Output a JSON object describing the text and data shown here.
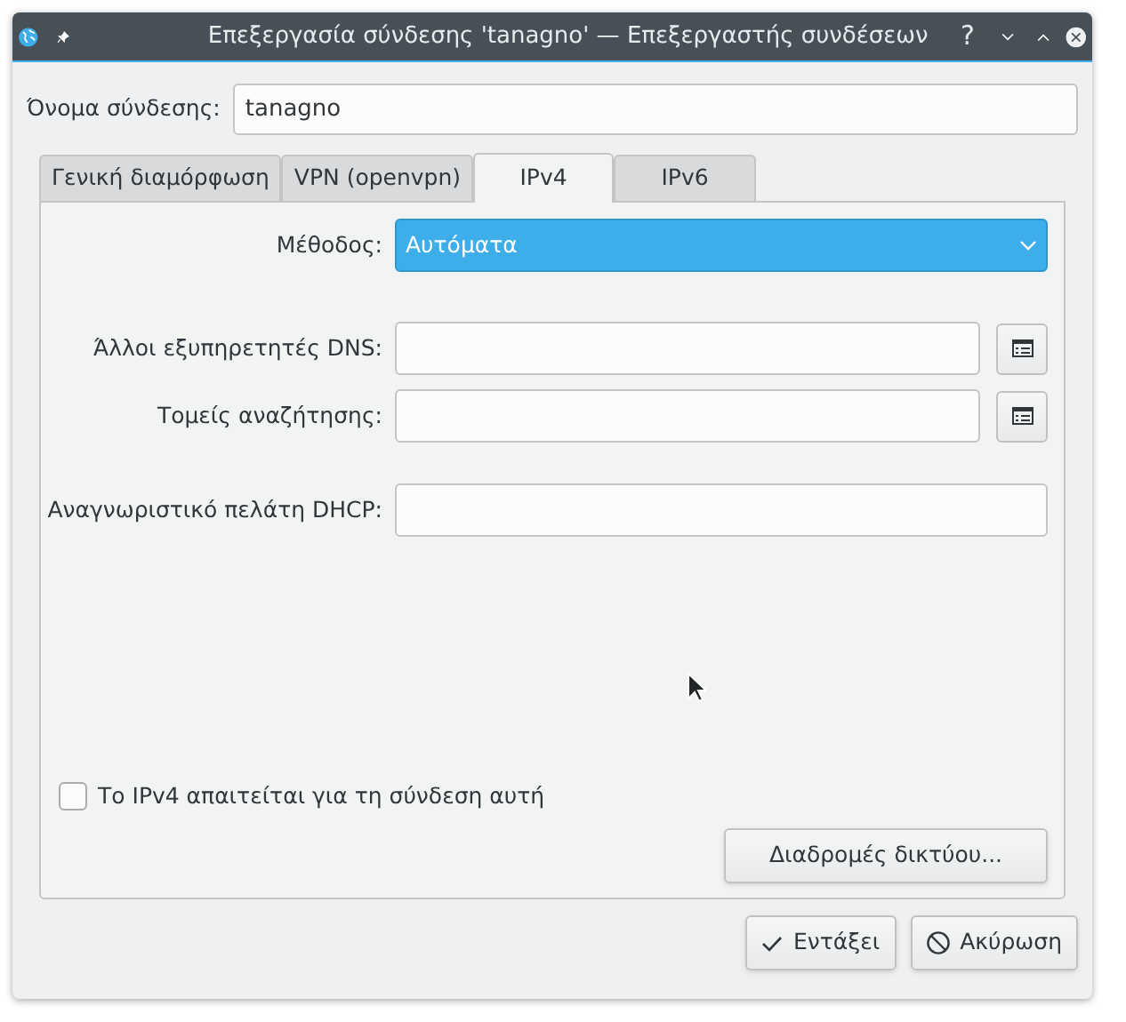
{
  "window": {
    "title": "Επεξεργασία σύνδεσης 'tanagno' — Επεξεργαστής συνδέσεων",
    "help": "?"
  },
  "connection_name": {
    "label": "Όνομα σύνδεσης:",
    "value": "tanagno"
  },
  "tabs": [
    {
      "label": "Γενική διαμόρφωση",
      "selected": false
    },
    {
      "label": "VPN (openvpn)",
      "selected": false
    },
    {
      "label": "IPv4",
      "selected": true
    },
    {
      "label": "IPv6",
      "selected": false
    }
  ],
  "method": {
    "label": "Μέθοδος:",
    "value": "Αυτόματα"
  },
  "fields": [
    {
      "label": "Άλλοι εξυπηρετητές DNS:",
      "kind": "list"
    },
    {
      "label": "Τομείς αναζήτησης:",
      "kind": "list"
    },
    {
      "label": "Αναγνωριστικό πελάτη DHCP:",
      "kind": "plain"
    }
  ],
  "required_checkbox": {
    "label": "Το IPv4 απαιτείται για τη σύνδεση αυτή",
    "checked": false
  },
  "routes_button": "Διαδρομές δικτύου...",
  "buttons": [
    {
      "label": "Εντάξει",
      "kind": "ok"
    },
    {
      "label": "Ακύρωση",
      "kind": "cancel"
    }
  ]
}
